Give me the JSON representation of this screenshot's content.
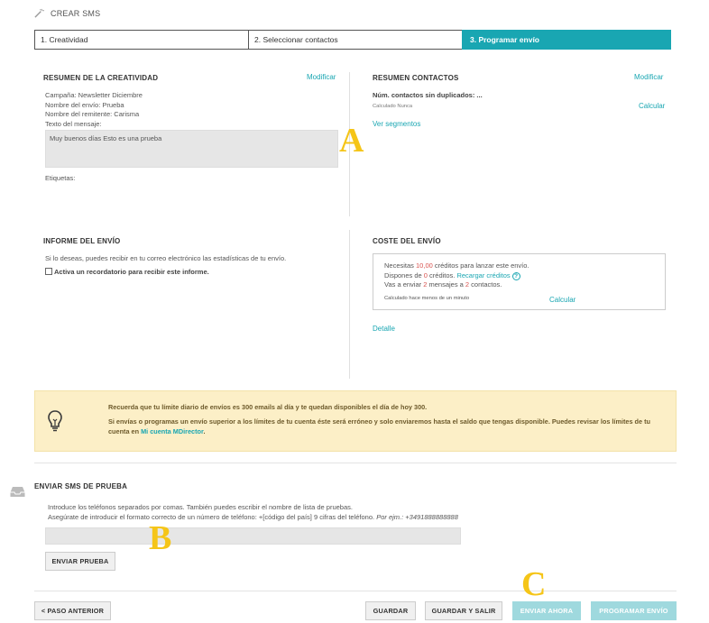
{
  "header": {
    "title": "CREAR SMS",
    "icon": "magic-wand-icon"
  },
  "steps": [
    {
      "label": "1. Creatividad",
      "active": false
    },
    {
      "label": "2. Seleccionar contactos",
      "active": false
    },
    {
      "label": "3. Programar envío",
      "active": true
    }
  ],
  "creatividad": {
    "title": "RESUMEN DE LA CREATIVIDAD",
    "modify": "Modificar",
    "campaign": "Campaña: Newsletter Diciembre",
    "send_name": "Nombre del envío: Prueba",
    "sender_name": "Nombre del remitente: Carisma",
    "message_label": "Texto del mensaje:",
    "message": "Muy buenos días Esto es una prueba",
    "tags_label": "Etiquetas:"
  },
  "contactos": {
    "title": "RESUMEN CONTACTOS",
    "modify": "Modificar",
    "count_label": "Núm. contactos sin duplicados: ...",
    "calc_status": "Calculado Nunca",
    "calc_link": "Calcular",
    "segments_link": "Ver segmentos"
  },
  "informe": {
    "title": "INFORME DEL ENVÍO",
    "desc": "Si lo deseas, puedes recibir en tu correo electrónico las estadísticas de tu envío.",
    "reminder": "Activa un recordatorio para recibir este informe."
  },
  "coste": {
    "title": "COSTE DEL ENVÍO",
    "need_prefix": "Necesitas ",
    "need_value": "10,00",
    "need_suffix": " créditos para lanzar este envío.",
    "have_prefix": "Dispones de ",
    "have_value": "0",
    "have_suffix": " créditos. ",
    "recharge": "Recargar créditos",
    "help": "?",
    "send_prefix": "Vas a enviar ",
    "send_msgs": "2",
    "send_mid": " mensajes a ",
    "send_contacts": "2",
    "send_suffix": " contactos.",
    "calc_status": "Calculado hace menos de un minuto",
    "calc_link": "Calcular",
    "detail": "Detalle"
  },
  "notice": {
    "line1": "Recuerda que tu límite diario de envíos es 300 emails al día y te quedan disponibles el día de hoy 300.",
    "line2": "Si envías o programas un envío superior a los límites de tu cuenta éste será erróneo y solo enviaremos hasta el saldo que tengas disponible. Puedes revisar los límites de tu",
    "line3_prefix": "cuenta en ",
    "line3_link": "Mi cuenta MDirector",
    "line3_suffix": "."
  },
  "test": {
    "title": "ENVIAR SMS DE PRUEBA",
    "instructions1": "Introduce los teléfonos separados por comas. También puedes escribir el nombre de lista de pruebas.",
    "instructions2_prefix": "Asegúrate de introducir el formato correcto de un número de teléfono: +[código del país] 9 cifras del teléfono. ",
    "instructions2_example": "Por ejm.: +3491888888888",
    "input_value": "",
    "button": "ENVIAR PRUEBA"
  },
  "footer": {
    "prev": "< PASO ANTERIOR",
    "save": "GUARDAR",
    "save_exit": "GUARDAR Y SALIR",
    "send_now": "ENVIAR AHORA",
    "schedule": "PROGRAMAR ENVÍO"
  },
  "annotations": {
    "a": "A",
    "b": "B",
    "c": "C"
  },
  "colors": {
    "accent": "#19a6b2",
    "notice_bg": "#fcefc7",
    "annotation": "#f5c518",
    "credit_red": "#d9534f"
  }
}
